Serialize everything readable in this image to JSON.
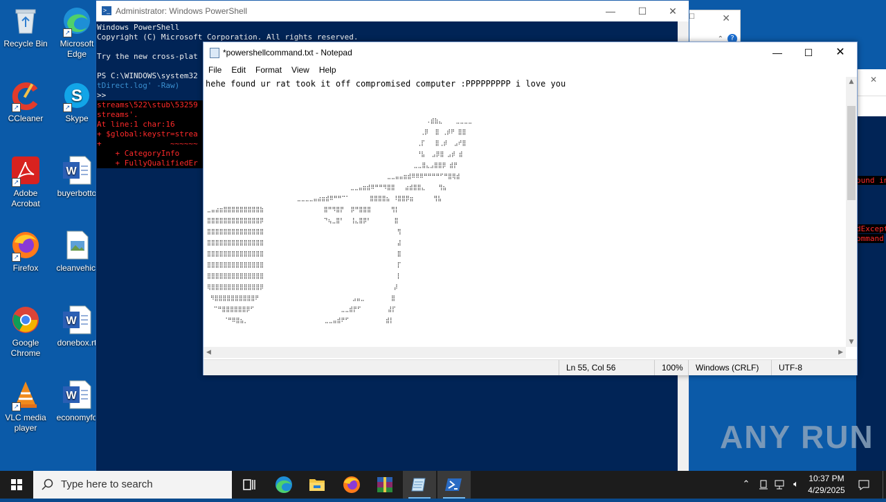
{
  "desktop_icons": [
    {
      "label": "Recycle Bin",
      "icon": "recycle-bin-icon"
    },
    {
      "label": "Microsoft Edge",
      "icon": "edge-icon"
    },
    {
      "label": "CCleaner",
      "icon": "ccleaner-icon"
    },
    {
      "label": "Skype",
      "icon": "skype-icon"
    },
    {
      "label": "Adobe Acrobat",
      "icon": "acrobat-icon"
    },
    {
      "label": "buyerbotto",
      "icon": "word-doc-icon"
    },
    {
      "label": "Firefox",
      "icon": "firefox-icon"
    },
    {
      "label": "cleanvehicl",
      "icon": "image-file-icon"
    },
    {
      "label": "Google Chrome",
      "icon": "chrome-icon"
    },
    {
      "label": "donebox.rt",
      "icon": "word-doc-icon"
    },
    {
      "label": "VLC media player",
      "icon": "vlc-icon"
    },
    {
      "label": "economyfo",
      "icon": "word-doc-icon"
    }
  ],
  "powershell": {
    "title": "Administrator: Windows PowerShell",
    "lines": [
      "Windows PowerShell",
      "Copyright (C) Microsoft Corporation. All rights reserved.",
      "",
      "Try the new cross-plat",
      "",
      "PS C:\\WINDOWS\\system32",
      ">>",
      "streams\\522\\stub\\53259",
      "streams'.",
      "At line:1 char:16",
      "+ $global:keystr=strea",
      "+               ~~~~~~",
      "    + CategoryInfo",
      "    + FullyQualifiedEr"
    ],
    "line6_cont": "tDirect.log' -Raw)",
    "right_fragments": [
      "ound in",
      "dExcept",
      "ommand"
    ]
  },
  "notepad": {
    "title": "*powershellcommand.txt - Notepad",
    "menu": [
      "File",
      "Edit",
      "Format",
      "View",
      "Help"
    ],
    "first_line": "hehe found ur rat took it off compromised computer :PPPPPPPPP i love you",
    "ascii_art": [
      "                                                                  .⣾⣷⣄    ⣀⣀⣀⣀",
      "                                                                ⢀⡿  ⣿ ⢀⡾⠟ ⣿⣿",
      "                                                               ⢀⡏   ⣿⢀⡾  ⣠⠞⣿",
      "                                                               ⠘⣧  ⣠⡿⣿ ⣠⡾ ⣾",
      "                                                              ⣀⣀⣿⣄⣠⣿⣿⡿ ⣾⡟",
      "                                                      ⣀⣀⣤⣤⣶⣾⠿⠿⠿⠛⠛⠛⠛⠋⠛⣿⢿⣾",
      "                                           ⣀⣀⣤⣶⣾⠿⠛⠛⠻⣿⣿   ⣴⣾⣿⣿⣄    ⢻⣦",
      "                           ⣀⣀⣀⣀⣤⣴⣶⣾⠿⠛⠛⠉⠁      ⣿⣿⣿⣿⣦ ⠸⣿⣿⡿⣶      ⢻⣧",
      "⣀⣤⣴⣶⣿⣿⣿⣿⣿⣿⣿⣿⣿⣷                  ⣿⠛⠻⣿⡟  ⡿⠛⣿⣿⣿      ⢻⡇",
      "⣿⣿⣿⣿⣿⣿⣿⣿⣿⣿⣿⣿⣿⡿                  ⠙⢦⣀⣿⠃  ⢸⣄⣿⡿⠃       ⣿",
      "⣿⣿⣿⣿⣿⣿⣿⣿⣿⣿⣿⣿⣿⣿                                        ⢻",
      "⣿⣿⣿⣿⣿⣿⣿⣿⣿⣿⣿⣿⣿⣿                                        ⣼",
      "⣿⣿⣿⣿⣿⣿⣿⣿⣿⣿⣿⣿⣿⣿                                        ⣿",
      "⣿⣿⣿⣿⣿⣿⣿⣿⣿⣿⣿⣿⣿⣿                                        ⡏",
      "⣿⣿⣿⣿⣿⣿⣿⣿⣿⣿⣿⣿⣿⣿                                        ⡇",
      "⢿⣿⣿⣿⣿⣿⣿⣿⣿⣿⣿⣿⣿⡿                                       ⡼",
      " ⠻⣿⣿⣿⣿⣿⣿⣿⣿⣿⣿⠟                            ⣠⣤⣀        ⣿",
      "  ⠉⠛⣿⣿⣿⣿⣿⣿⡿⠋                          ⣀⣀⣾⡟⠋        ⣼⡏",
      "     ⠈⠛⠿⣿⣦⡀                       ⣀⣀⣤⣾⠟⠋           ⣾⡇"
    ],
    "status": {
      "position": "Ln 55, Col 56",
      "zoom": "100%",
      "line_ending": "Windows (CRLF)",
      "encoding": "UTF-8"
    }
  },
  "watermark": "ANY RUN",
  "taskbar": {
    "search_placeholder": "Type here to search",
    "apps": [
      "task-view-icon",
      "edge-icon",
      "file-explorer-icon",
      "firefox-icon",
      "winrar-icon",
      "notepad-icon",
      "powershell-icon"
    ],
    "time": "10:37 PM",
    "date": "4/29/2025"
  },
  "colors": {
    "desktop": "#0b5aa8",
    "powershell_bg": "#012456",
    "error_text": "#ff2a2a",
    "taskbar": "#1c1c1c"
  }
}
